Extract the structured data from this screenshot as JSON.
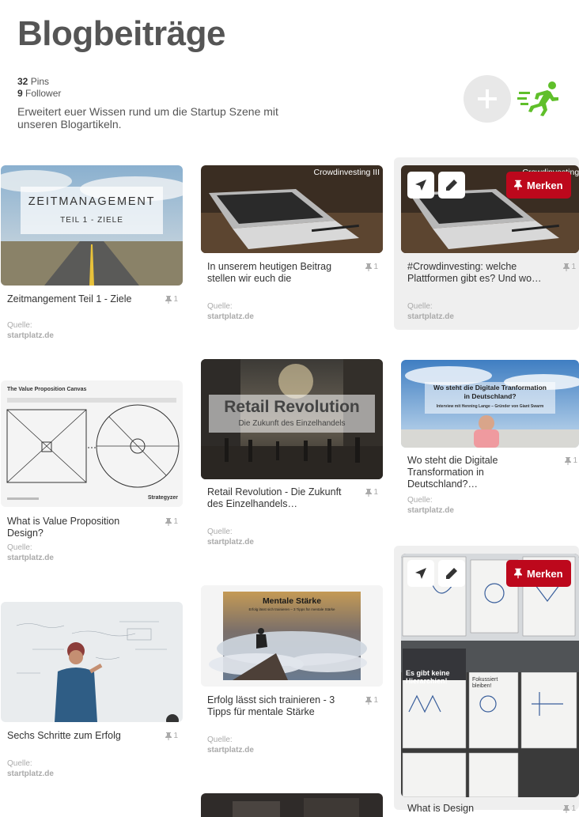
{
  "board": {
    "title": "Blogbeiträge",
    "pins_count": "32",
    "pins_label": "Pins",
    "followers_count": "9",
    "followers_label": "Follower",
    "description": "Erweitert euer Wissen rund um die Startup Szene mit unseren Blogartikeln."
  },
  "icons": {
    "add": "plus-icon",
    "profile": "running-man-icon",
    "send": "send-icon",
    "edit": "pencil-icon",
    "pin": "pushpin-icon"
  },
  "colors": {
    "merken": "#bd081c",
    "runner": "#5fbf2a"
  },
  "actions": {
    "save_label": "Merken"
  },
  "source_label": "Quelle:",
  "pins": [
    {
      "title": "Zeitmangement Teil 1 - Ziele",
      "repins": "1",
      "domain": "startplatz.de",
      "image_title": "ZEITMANAGEMENT",
      "image_subtitle": "TEIL 1 - ZIELE"
    },
    {
      "title": "In unserem heutigen Beitrag stellen wir euch die",
      "repins": "1",
      "domain": "startplatz.de",
      "image_label": "Crowdinvesting III"
    },
    {
      "title": "#Crowdinvesting: welche Plattformen gibt es? Und wo…",
      "repins": "1",
      "domain": "startplatz.de",
      "image_label": "Crowdinvesting I"
    },
    {
      "title": "What is Value Proposition Design?",
      "repins": "1",
      "domain": "startplatz.de",
      "image_title": "The Value Proposition Canvas",
      "image_brand": "Strategyzer"
    },
    {
      "title": "Retail Revolution - Die Zukunft des Einzelhandels…",
      "repins": "1",
      "domain": "startplatz.de",
      "image_title": "Retail Revolution",
      "image_subtitle": "Die Zukunft des Einzelhandels"
    },
    {
      "title": "Wo steht die Digitale Transformation in Deutschland?…",
      "repins": "1",
      "domain": "startplatz.de",
      "image_title": "Wo steht die Digitale Tranformation in Deutschland?",
      "image_subtitle": "Interview mit Henning Lange – Gründer von Giant Swarm"
    },
    {
      "title": "Sechs Schritte zum Erfolg",
      "repins": "1",
      "domain": "startplatz.de"
    },
    {
      "title": "Erfolg lässt sich trainieren - 3 Tipps für mentale Stärke",
      "repins": "1",
      "domain": "startplatz.de",
      "image_title": "Mentale Stärke",
      "image_subtitle": "Erfolg lässt sich trainieren – 3 Tipps für mentale Stärke"
    },
    {
      "title": "What is Design",
      "repins": "1",
      "image_sign_1": "Es gibt keine Hierarchien!",
      "image_sign_2": "Fokussiert bleiben!"
    }
  ]
}
